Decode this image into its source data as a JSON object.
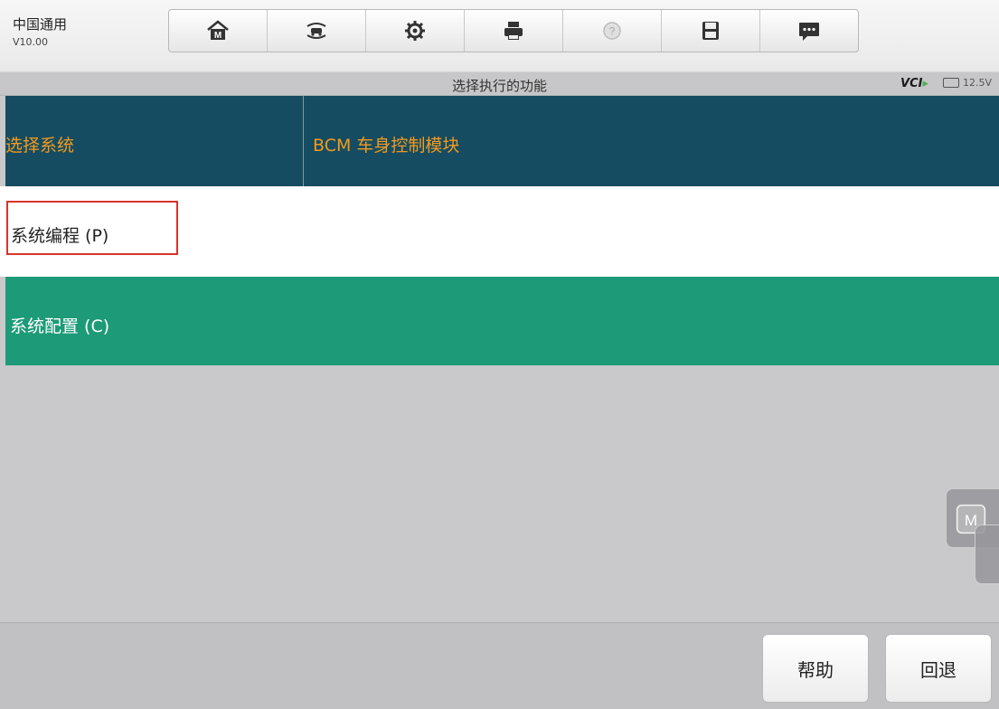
{
  "app": {
    "name": "中国通用",
    "version": "V10.00"
  },
  "toolbar": {
    "icons": [
      "home-icon",
      "vehicle-swap-icon",
      "gear-icon",
      "printer-icon",
      "help-icon",
      "save-icon",
      "message-icon"
    ]
  },
  "titlebar": {
    "title": "选择执行的功能",
    "vci_label": "VCI",
    "voltage": "12.5V"
  },
  "header": {
    "col1": "选择系统",
    "col2": "BCM 车身控制模块"
  },
  "functions": [
    {
      "label": "系统编程 (P)",
      "highlighted": true
    },
    {
      "label": "系统配置 (C)",
      "selected": true
    }
  ],
  "colors": {
    "header_bg": "#164c62",
    "header_text": "#f39a1b",
    "selected_row": "#1d9a77",
    "highlight_box": "#d9342a"
  },
  "buttons": {
    "help": "帮助",
    "back": "回退"
  }
}
